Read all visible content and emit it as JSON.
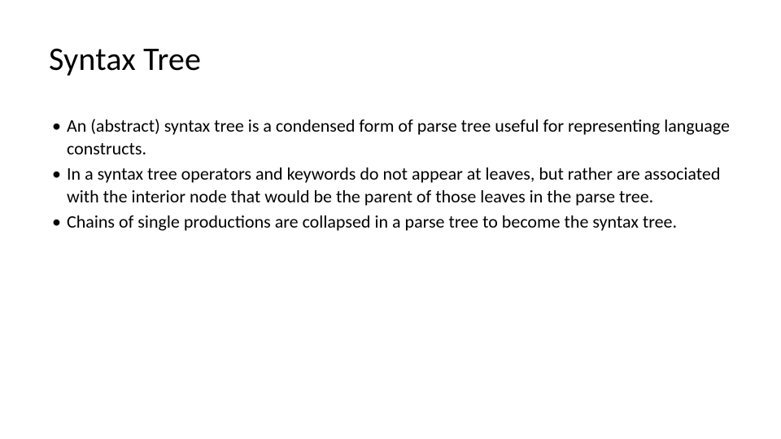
{
  "slide": {
    "title": "Syntax Tree",
    "bullets": [
      "An (abstract) syntax tree is a condensed form of parse tree useful for representing language constructs.",
      "In a syntax tree operators and keywords do not appear at leaves, but rather are associated with the interior node that would be the parent of those leaves in the parse tree.",
      "Chains of single productions are collapsed in a parse tree to become the syntax tree."
    ]
  }
}
